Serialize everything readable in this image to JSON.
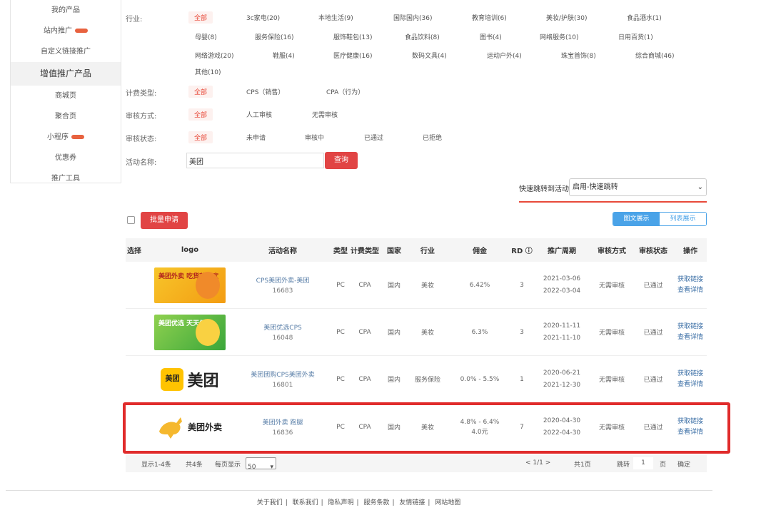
{
  "sidebar": {
    "items": [
      {
        "label": "我的产品",
        "badge": false
      },
      {
        "label": "站内推广",
        "badge": true
      },
      {
        "label": "自定义链接推广",
        "badge": false
      },
      {
        "label": "增值推广产品",
        "badge": false,
        "active": true
      },
      {
        "label": "商城页",
        "badge": false
      },
      {
        "label": "聚合页",
        "badge": false
      },
      {
        "label": "小程序",
        "badge": true
      },
      {
        "label": "优惠券",
        "badge": false
      },
      {
        "label": "推广工具",
        "badge": false
      }
    ]
  },
  "filters": {
    "industry_label": "行业:",
    "industry_options": [
      "全部",
      "3c家电(20)",
      "本地生活(9)",
      "国际国内(36)",
      "教育培训(6)",
      "美妆/护肤(30)",
      "食品酒水(1)",
      "母婴(8)",
      "服务保险(16)",
      "服饰鞋包(13)",
      "食品饮料(8)",
      "图书(4)",
      "网络服务(10)",
      "日用百货(1)",
      "网络游戏(20)",
      "鞋服(4)",
      "医疗健康(16)",
      "数码文具(4)",
      "运动户外(4)",
      "珠宝首饰(8)",
      "综合商城(46)",
      "其他(10)"
    ],
    "billing_label": "计费类型:",
    "billing_options": [
      "全部",
      "CPS（销售）",
      "CPA（行为）"
    ],
    "audit_label": "审核方式:",
    "audit_options": [
      "全部",
      "人工审核",
      "无需审核"
    ],
    "status_label": "审核状态:",
    "status_options": [
      "全部",
      "未申请",
      "审核中",
      "已通过",
      "已拒绝"
    ],
    "name_label": "活动名称:",
    "name_value": "美团",
    "search_button": "查询",
    "quick_label": "快速跳转到活动:",
    "quick_value": "启用-快速跳转"
  },
  "actions": {
    "batch_button": "批量申请",
    "view_a": "图文展示",
    "view_b": "列表展示"
  },
  "table": {
    "headers": [
      "选择",
      "logo",
      "活动名称",
      "类型",
      "计费类型",
      "国家",
      "行业",
      "佣金",
      "RD",
      "推广周期",
      "审核方式",
      "审核状态",
      "操作"
    ],
    "rows": [
      {
        "logo_text": "美团外卖 吃货节狂欢",
        "name": "CPS美团外卖-美团",
        "id": "16683",
        "type": "PC",
        "billing": "CPA",
        "country": "国内",
        "industry": "美妆",
        "commission": "6.42%",
        "rd": "3",
        "start": "2021-03-06",
        "end": "2022-03-04",
        "audit": "无需审核",
        "status": "已通过",
        "op1": "获取链接",
        "op2": "查看详情"
      },
      {
        "logo_text": "美团优选 天天低价",
        "name": "美团优选CPS",
        "id": "16048",
        "type": "PC",
        "billing": "CPA",
        "country": "国内",
        "industry": "美妆",
        "commission": "6.3%",
        "rd": "3",
        "start": "2020-11-11",
        "end": "2021-11-10",
        "audit": "无需审核",
        "status": "已通过",
        "op1": "获取链接",
        "op2": "查看详情"
      },
      {
        "logo_text": "美团",
        "name": "美团团购CPS美团外卖",
        "id": "16801",
        "type": "PC",
        "billing": "CPA",
        "country": "国内",
        "industry": "服务保险",
        "commission": "0.0% - 5.5%",
        "rd": "1",
        "start": "2020-06-21",
        "end": "2021-12-30",
        "audit": "无需审核",
        "status": "已通过",
        "op1": "获取链接",
        "op2": "查看详情"
      },
      {
        "logo_text": "美团外卖",
        "name": "美团外卖 跑腿",
        "id": "16836",
        "type": "PC",
        "billing": "CPA",
        "country": "国内",
        "industry": "美妆",
        "commission": "4.8% - 6.4% 4.0元",
        "rd": "7",
        "start": "2020-04-30",
        "end": "2022-04-30",
        "audit": "无需审核",
        "status": "已通过",
        "op1": "获取链接",
        "op2": "查看详情"
      }
    ]
  },
  "pager": {
    "summary": "显示1-4条",
    "total": "共4条",
    "per_page_label": "每页显示",
    "per_page_value": "50",
    "nav": "< 1/1 >",
    "pages": "共1页",
    "goto_label": "跳转",
    "goto_value": "1",
    "goto_unit": "页",
    "confirm": "确定"
  },
  "footer": {
    "links": [
      "关于我们",
      "联系我们",
      "隐私声明",
      "服务条款",
      "友情链接",
      "网站地图"
    ]
  },
  "colors": {
    "accent": "#e14444",
    "link": "#3a6ea5",
    "toggle": "#4aa3e8",
    "highlight": "#e02b2b"
  }
}
